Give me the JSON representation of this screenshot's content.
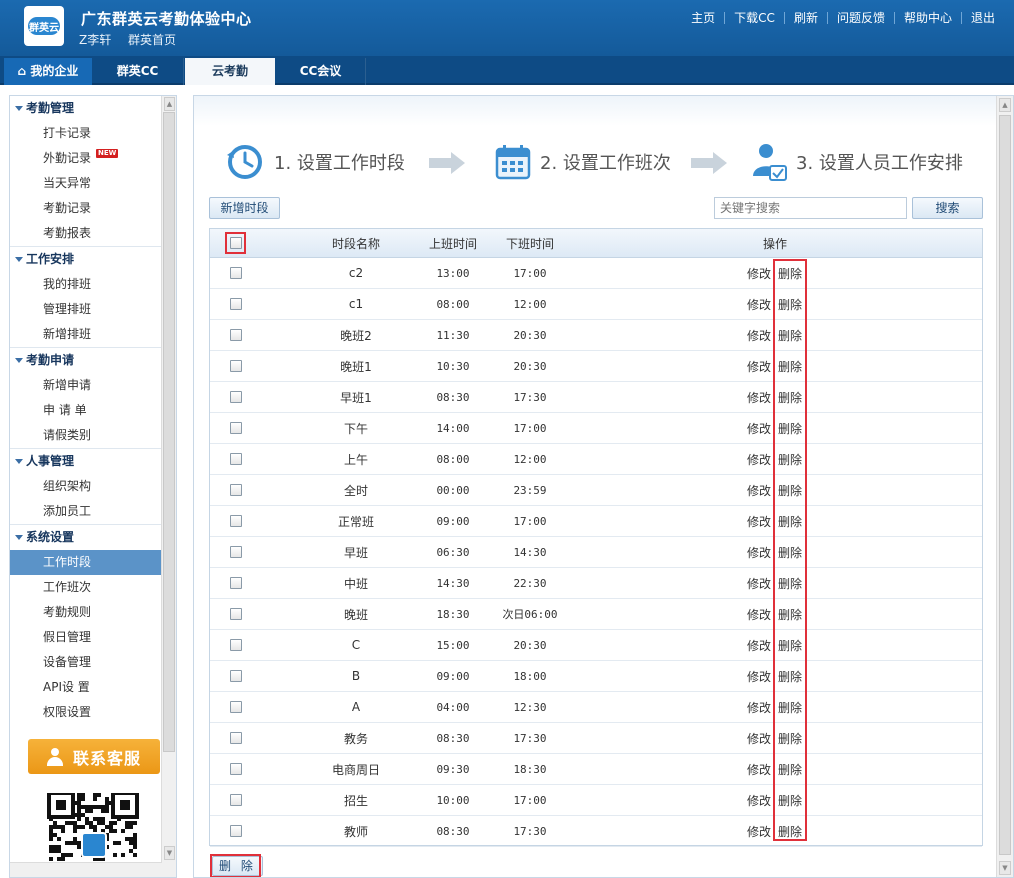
{
  "header": {
    "logo_text": "群英云",
    "title": "广东群英云考勤体验中心",
    "user": "Z李轩",
    "home_link": "群英首页",
    "links": [
      "主页",
      "下载CC",
      "刷新",
      "问题反馈",
      "帮助中心",
      "退出"
    ]
  },
  "nav": {
    "tabs": [
      "我的企业",
      "群英CC",
      "云考勤",
      "CC会议"
    ],
    "active": "云考勤"
  },
  "sidebar": {
    "groups": [
      {
        "title": "考勤管理",
        "items": [
          "打卡记录",
          "外勤记录",
          "当天异常",
          "考勤记录",
          "考勤报表"
        ]
      },
      {
        "title": "工作安排",
        "items": [
          "我的排班",
          "管理排班",
          "新增排班"
        ]
      },
      {
        "title": "考勤申请",
        "items": [
          "新增申请",
          "申 请 单",
          "请假类别"
        ]
      },
      {
        "title": "人事管理",
        "items": [
          "组织架构",
          "添加员工"
        ]
      },
      {
        "title": "系统设置",
        "items": [
          "工作时段",
          "工作班次",
          "考勤规则",
          "假日管理",
          "设备管理",
          "API设 置",
          "权限设置"
        ]
      }
    ],
    "new_badge": "NEW",
    "active_item": "工作时段",
    "service_button": "联系客服"
  },
  "steps": {
    "step1": "1. 设置工作时段",
    "step2": "2. 设置工作班次",
    "step3": "3. 设置人员工作安排"
  },
  "toolbar": {
    "add_label": "新增时段",
    "search_placeholder": "关键字搜索",
    "search_label": "搜索",
    "delete_label": "删 除"
  },
  "table": {
    "headers": {
      "name": "时段名称",
      "start": "上班时间",
      "end": "下班时间",
      "op": "操作"
    },
    "edit_label": "修改",
    "delete_label": "删除",
    "rows": [
      {
        "name": "c2",
        "start": "13:00",
        "end": "17:00"
      },
      {
        "name": "c1",
        "start": "08:00",
        "end": "12:00"
      },
      {
        "name": "晚班2",
        "start": "11:30",
        "end": "20:30"
      },
      {
        "name": "晚班1",
        "start": "10:30",
        "end": "20:30"
      },
      {
        "name": "早班1",
        "start": "08:30",
        "end": "17:30"
      },
      {
        "name": "下午",
        "start": "14:00",
        "end": "17:00"
      },
      {
        "name": "上午",
        "start": "08:00",
        "end": "12:00"
      },
      {
        "name": "全时",
        "start": "00:00",
        "end": "23:59"
      },
      {
        "name": "正常班",
        "start": "09:00",
        "end": "17:00"
      },
      {
        "name": "早班",
        "start": "06:30",
        "end": "14:30"
      },
      {
        "name": "中班",
        "start": "14:30",
        "end": "22:30"
      },
      {
        "name": "晚班",
        "start": "18:30",
        "end": "次日06:00"
      },
      {
        "name": "C",
        "start": "15:00",
        "end": "20:30"
      },
      {
        "name": "B",
        "start": "09:00",
        "end": "18:00"
      },
      {
        "name": "A",
        "start": "04:00",
        "end": "12:30"
      },
      {
        "name": "教务",
        "start": "08:30",
        "end": "17:30"
      },
      {
        "name": "电商周日",
        "start": "09:30",
        "end": "18:30"
      },
      {
        "name": "招生",
        "start": "10:00",
        "end": "17:00"
      },
      {
        "name": "教师",
        "start": "08:30",
        "end": "17:30"
      }
    ]
  },
  "colors": {
    "header_blue": "#1769b5",
    "highlight_red": "#e0303a",
    "service_orange": "#f0a020"
  }
}
